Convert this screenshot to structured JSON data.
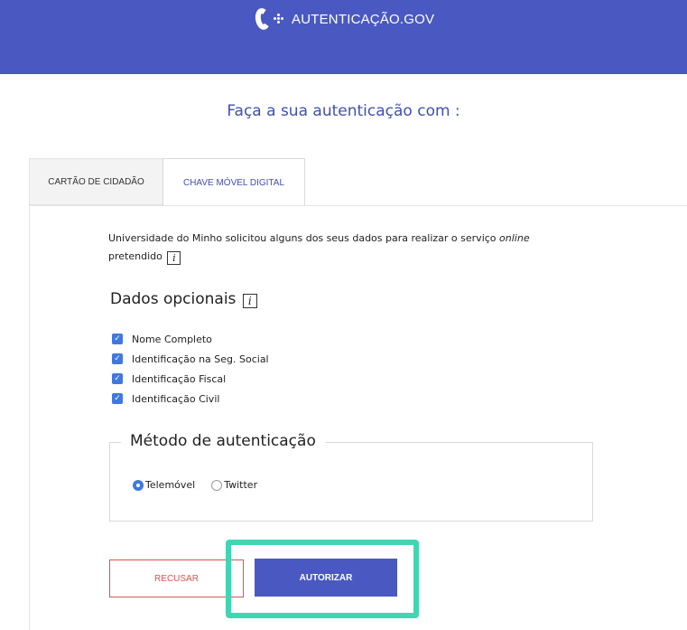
{
  "header": {
    "brand_text": "AUTENTICAÇÃO.GOV"
  },
  "page": {
    "title": "Faça a sua autenticação com :"
  },
  "tabs": [
    {
      "label": "CARTÃO DE CIDADÃO",
      "active": false
    },
    {
      "label": "CHAVE MÓVEL DIGITAL",
      "active": true
    }
  ],
  "intro": {
    "requester": "Universidade do Minho",
    "text_before_online": " solicitou alguns dos seus dados para realizar o serviço ",
    "online": "online",
    "text_after": "pretendido",
    "info_icon": "i"
  },
  "optional_data": {
    "heading": "Dados opcionais",
    "info_icon": "i",
    "items": [
      {
        "label": "Nome Completo",
        "checked": true
      },
      {
        "label": "Identificação na Seg. Social",
        "checked": true
      },
      {
        "label": "Identificação Fiscal",
        "checked": true
      },
      {
        "label": "Identificação Civil",
        "checked": true
      }
    ]
  },
  "auth_method": {
    "legend": "Método de autenticação",
    "options": [
      {
        "label": "Telemóvel",
        "selected": true
      },
      {
        "label": "Twitter",
        "selected": false
      }
    ]
  },
  "actions": {
    "refuse_label": "RECUSAR",
    "authorize_label": "AUTORIZAR"
  },
  "colors": {
    "brand_blue": "#4a59c1",
    "refuse_red": "#d9534f",
    "highlight_teal": "#3fd6b2",
    "checkbox_blue": "#3f78e0"
  }
}
